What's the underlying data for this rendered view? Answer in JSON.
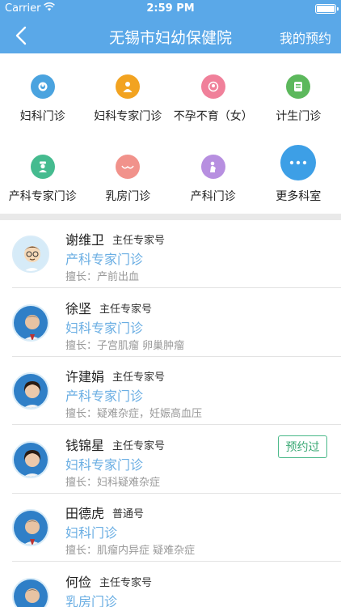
{
  "status_bar": {
    "carrier": "Carrier",
    "time": "2:59 PM"
  },
  "nav": {
    "title": "无锡市妇幼保健院",
    "right_label": "我的预约"
  },
  "departments": [
    {
      "label": "妇科门诊",
      "icon": "female-icon",
      "color": "#4aa3df"
    },
    {
      "label": "妇科专家门诊",
      "icon": "expert-icon",
      "color": "#f2a321"
    },
    {
      "label": "不孕不育（女）",
      "icon": "baby-icon",
      "color": "#f0809a"
    },
    {
      "label": "计生门诊",
      "icon": "family-planning-icon",
      "color": "#5cb85c"
    },
    {
      "label": "产科专家门诊",
      "icon": "nurse-icon",
      "color": "#45bb8f"
    },
    {
      "label": "乳房门诊",
      "icon": "breast-icon",
      "color": "#f1928b"
    },
    {
      "label": "产科门诊",
      "icon": "mother-icon",
      "color": "#b78fe0"
    },
    {
      "label": "更多科室",
      "icon": "more-icon",
      "color": "#3d9fe6"
    }
  ],
  "doctors": [
    {
      "name": "谢维卫",
      "title": "主任专家号",
      "dept": "产科专家门诊",
      "skill": "擅长：产前出血",
      "badge": "",
      "avatar": "cartoon"
    },
    {
      "name": "徐坚",
      "title": "主任专家号",
      "dept": "妇科专家门诊",
      "skill": "擅长：子宫肌瘤 卵巢肿瘤",
      "badge": "",
      "avatar": "male"
    },
    {
      "name": "许建娟",
      "title": "主任专家号",
      "dept": "产科专家门诊",
      "skill": "擅长：疑难杂症，妊娠高血压",
      "badge": "",
      "avatar": "female"
    },
    {
      "name": "钱锦星",
      "title": "主任专家号",
      "dept": "妇科专家门诊",
      "skill": "擅长：妇科疑难杂症",
      "badge": "预约过",
      "avatar": "female"
    },
    {
      "name": "田德虎",
      "title": "普通号",
      "dept": "妇科门诊",
      "skill": "擅长：肌瘤内异症 疑难杂症",
      "badge": "",
      "avatar": "male"
    },
    {
      "name": "何俭",
      "title": "主任专家号",
      "dept": "乳房门诊",
      "skill": "",
      "badge": "",
      "avatar": "male"
    }
  ]
}
